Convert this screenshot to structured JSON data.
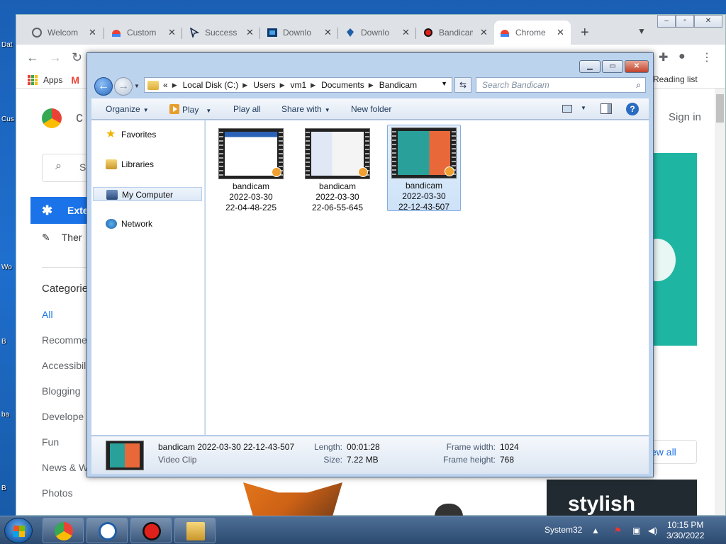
{
  "desktop": {
    "icons": [
      "Dat",
      "Cus",
      "Wo",
      "B",
      "ba",
      "B"
    ]
  },
  "chrome": {
    "tabs": [
      {
        "title": "Welcom",
        "icon": "puzzle-tab-icon"
      },
      {
        "title": "Custom",
        "icon": "chrome-store-icon"
      },
      {
        "title": "Success",
        "icon": "arrow-cursor-icon"
      },
      {
        "title": "Downlo",
        "icon": "download-site-icon"
      },
      {
        "title": "Downlo",
        "icon": "download-tray-icon"
      },
      {
        "title": "Bandicam",
        "icon": "bandicam-icon"
      },
      {
        "title": "Chrome",
        "icon": "chrome-store-icon"
      }
    ],
    "new_tab": "+",
    "bookmarks": {
      "apps": "Apps",
      "reading_list": "Reading list"
    },
    "store": {
      "logo_partial": "c",
      "search_partial": "S",
      "active_item": "Exte",
      "themes_partial": "Ther",
      "categories_title": "Categorie",
      "categories": [
        "All",
        "Recomme",
        "Accessibil",
        "Blogging",
        "Develope",
        "Fun",
        "News & W",
        "Photos"
      ],
      "sign_in": "Sign in",
      "view_all": "ew all",
      "stylish_partial": "stylish"
    }
  },
  "explorer": {
    "breadcrumb": [
      "«",
      "Local Disk (C:)",
      "Users",
      "vm1",
      "Documents",
      "Bandicam"
    ],
    "search_placeholder": "Search Bandicam",
    "commands": {
      "organize": "Organize",
      "play": "Play",
      "play_all": "Play all",
      "share_with": "Share with",
      "new_folder": "New folder"
    },
    "nav": [
      {
        "label": "Favorites"
      },
      {
        "label": "Libraries"
      },
      {
        "label": "My Computer"
      },
      {
        "label": "Network"
      }
    ],
    "files": [
      {
        "name": "bandicam",
        "date": "2022-03-30",
        "time": "22-04-48-225"
      },
      {
        "name": "bandicam",
        "date": "2022-03-30",
        "time": "22-06-55-645"
      },
      {
        "name": "bandicam",
        "date": "2022-03-30",
        "time": "22-12-43-507"
      }
    ],
    "details": {
      "name": "bandicam 2022-03-30 22-12-43-507",
      "type": "Video Clip",
      "length_label": "Length:",
      "length": "00:01:28",
      "size_label": "Size:",
      "size": "7.22 MB",
      "frame_width_label": "Frame width:",
      "frame_width": "1024",
      "frame_height_label": "Frame height:",
      "frame_height": "768"
    }
  },
  "taskbar": {
    "user": "System32",
    "time": "10:15 PM",
    "date": "3/30/2022"
  }
}
